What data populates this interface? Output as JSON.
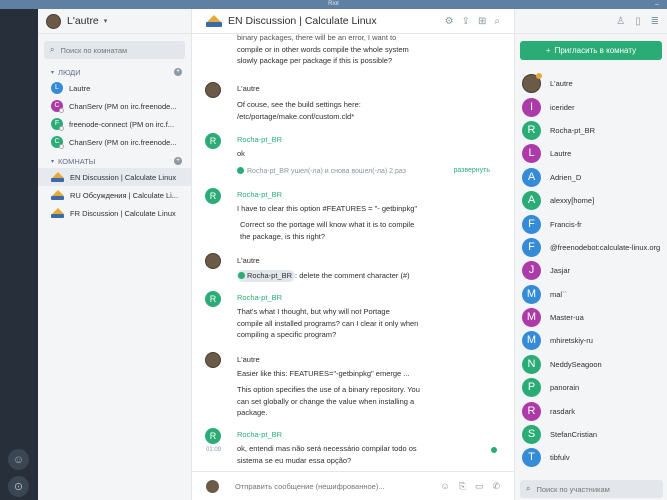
{
  "window": {
    "title": "Riot"
  },
  "user": {
    "name": "L'autre"
  },
  "roomlist": {
    "search_placeholder": "Поиск по комнатам",
    "people_header": "ЛЮДИ",
    "rooms_header": "КОМНАТЫ",
    "people": [
      {
        "initial": "L",
        "name": "Lautre",
        "color": "#368bd6"
      },
      {
        "initial": "C",
        "name": "ChanServ (PM on irc.freenode...",
        "color": "#ac3ba8"
      },
      {
        "initial": "F",
        "name": "freenode-connect (PM on irc.f...",
        "color": "#2bac76"
      },
      {
        "initial": "C",
        "name": "ChanServ (PM on irc.freenode...",
        "color": "#2bac76"
      }
    ],
    "rooms": [
      {
        "name": "EN Discussion | Calculate Linux"
      },
      {
        "name": "RU Обсуждения | Calculate Li..."
      },
      {
        "name": "FR Discussion | Calculate Linux"
      }
    ]
  },
  "room": {
    "title": "EN Discussion | Calculate Linux"
  },
  "timeline": {
    "top_fragment": [
      "binary packages, there will be an error, I want to",
      "compile or in other words compile the whole system",
      "slowly package per package if this is possible?"
    ],
    "m1_sender": "L'autre",
    "m1_lines": [
      "Of couse, see the build settings here:",
      "/etc/portage/make.conf/custom.cld*"
    ],
    "m2_sender": "Rocha-pt_BR",
    "m2_text": "ok",
    "event_text": "Rocha-pt_BR ушел(-ла) и снова вошел(-ла) 2 раз",
    "event_expand": "развернуть",
    "m3_sender": "Rocha-pt_BR",
    "m3_text": "I have to clear this option #FEATURES = \"- getbinpkg\"",
    "m3b_lines": [
      "Correct so the portage will know what it is to compile",
      "the package, is this right?"
    ],
    "m4_sender": "L'autre",
    "m4_pill": "Rocha-pt_BR",
    "m4_text": ": delete the comment character (#)",
    "m5_sender": "Rocha-pt_BR",
    "m5_lines": [
      "That's what I thought, but why will not Portage",
      "compile all installed programs? can I clear it only when",
      "compiling a specific program?"
    ],
    "m6_sender": "L'autre",
    "m6_text": "Easier like this: FEATURES=\"-getbinpkg\" emerge ...",
    "m6b_lines": [
      "This option specifies the use of a binary repository. You",
      "can set globally or change the value when installing a",
      "package."
    ],
    "m7_sender": "Rocha-pt_BR",
    "m7_time": "01:09",
    "m7_lines": [
      "ok, entendi mas não será necessário compilar todo os",
      "sistema se eu mudar essa opção?"
    ]
  },
  "composer": {
    "placeholder": "Отправить сообщение (нешифрованное)..."
  },
  "members_panel": {
    "invite_label": "Пригласить в комнату",
    "search_placeholder": "Поиск по участникам",
    "members": [
      {
        "initial": "",
        "name": "L'autre",
        "color": "#6b5a48"
      },
      {
        "initial": "I",
        "name": "icerider",
        "color": "#ac3ba8"
      },
      {
        "initial": "R",
        "name": "Rocha-pt_BR",
        "color": "#2bac76"
      },
      {
        "initial": "L",
        "name": "Lautre",
        "color": "#ac3ba8"
      },
      {
        "initial": "A",
        "name": "Adrien_D",
        "color": "#368bd6"
      },
      {
        "initial": "A",
        "name": "alexxy[home]",
        "color": "#2bac76"
      },
      {
        "initial": "F",
        "name": "Francis-fr",
        "color": "#368bd6"
      },
      {
        "initial": "F",
        "name": "@freenodebot:calculate-linux.org",
        "color": "#368bd6"
      },
      {
        "initial": "J",
        "name": "Jasjar",
        "color": "#ac3ba8"
      },
      {
        "initial": "M",
        "name": "mal``",
        "color": "#368bd6"
      },
      {
        "initial": "M",
        "name": "Master-ua",
        "color": "#ac3ba8"
      },
      {
        "initial": "M",
        "name": "mhiretskiy-ru",
        "color": "#368bd6"
      },
      {
        "initial": "N",
        "name": "NeddySeagoon",
        "color": "#2bac76"
      },
      {
        "initial": "P",
        "name": "panorain",
        "color": "#2bac76"
      },
      {
        "initial": "R",
        "name": "rasdark",
        "color": "#ac3ba8"
      },
      {
        "initial": "S",
        "name": "StefanCristian",
        "color": "#2bac76"
      },
      {
        "initial": "T",
        "name": "tibfulv",
        "color": "#368bd6"
      }
    ]
  }
}
